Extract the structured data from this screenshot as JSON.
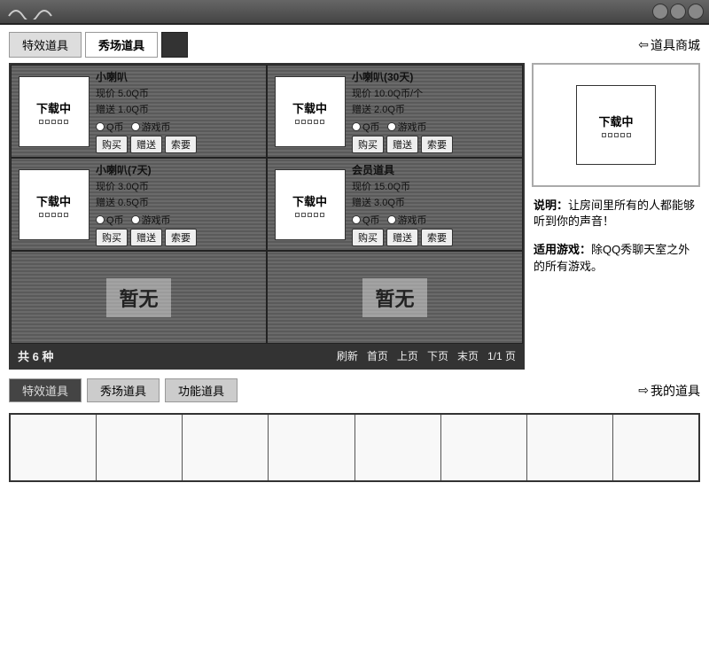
{
  "window": {
    "title": ""
  },
  "top_tabs": [
    {
      "label": "特效道具",
      "active": false
    },
    {
      "label": "秀场道具",
      "active": true
    },
    {
      "label": "",
      "active": false
    }
  ],
  "shop_link": "道具商城",
  "items": [
    {
      "thumb_label": "下载中",
      "name": "小喇叭",
      "line1": "现价 5.0Q币",
      "line2": "赠送 1.0Q币",
      "cur1": "Q币",
      "cur2": "游戏币",
      "buy": "购买",
      "gift": "赠送",
      "want": "索要"
    },
    {
      "thumb_label": "下载中",
      "name": "小喇叭(30天)",
      "line1": "现价 10.0Q币/个",
      "line2": "赠送 2.0Q币",
      "cur1": "Q币",
      "cur2": "游戏币",
      "buy": "购买",
      "gift": "赠送",
      "want": "索要"
    },
    {
      "thumb_label": "下载中",
      "name": "小喇叭(7天)",
      "line1": "现价 3.0Q币",
      "line2": "赠送 0.5Q币",
      "cur1": "Q币",
      "cur2": "游戏币",
      "buy": "购买",
      "gift": "赠送",
      "want": "索要"
    },
    {
      "thumb_label": "下载中",
      "name": "会员道具",
      "line1": "现价 15.0Q币",
      "line2": "赠送 3.0Q币",
      "cur1": "Q币",
      "cur2": "游戏币",
      "buy": "购买",
      "gift": "赠送",
      "want": "索要"
    }
  ],
  "placeholders": [
    {
      "label": "暂无"
    },
    {
      "label": "暂无"
    }
  ],
  "grid_footer": {
    "count": "共 6 种",
    "refresh": "刷新",
    "first": "首页",
    "prev": "上页",
    "next": "下页",
    "last": "末页",
    "page": "1/1 页"
  },
  "side": {
    "preview_label": "下载中",
    "desc_label": "说明：",
    "desc_text": "让房间里所有的人都能够听到你的声音！",
    "scope_label": "适用游戏：",
    "scope_text": "除QQ秀聊天室之外的所有游戏。"
  },
  "bottom_tabs": [
    {
      "label": "特效道具"
    },
    {
      "label": "秀场道具"
    },
    {
      "label": "功能道具"
    }
  ],
  "my_items_link": "我的道具",
  "inventory_slots": 8
}
